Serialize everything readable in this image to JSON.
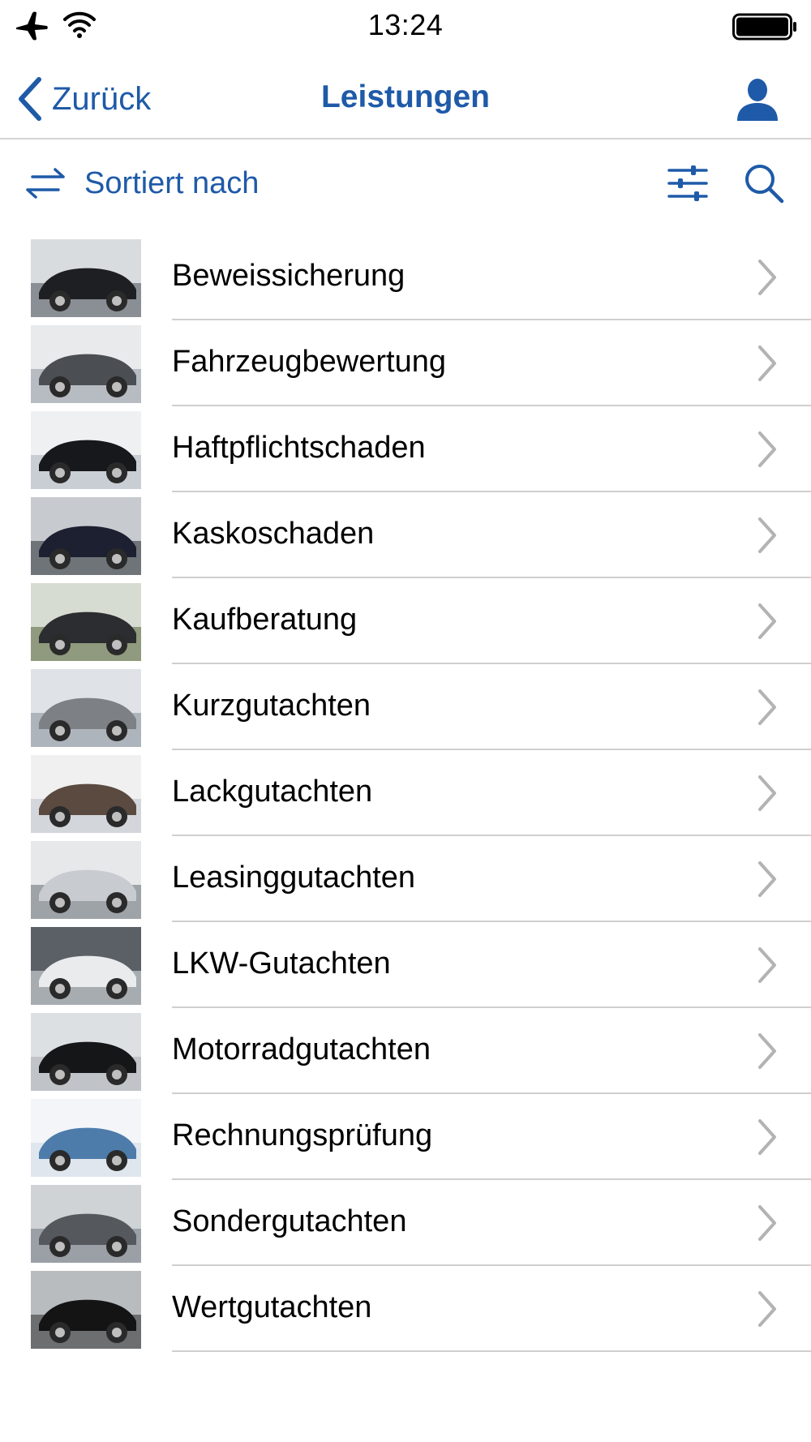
{
  "status_bar": {
    "time": "13:24",
    "icons": [
      "airplane-icon",
      "wifi-icon",
      "battery-icon"
    ]
  },
  "nav": {
    "back_label": "Zurück",
    "title": "Leistungen",
    "profile_icon": "person-icon"
  },
  "toolbar": {
    "sort_label": "Sortiert nach",
    "icons": [
      "sort-arrows-icon",
      "filter-sliders-icon",
      "search-icon"
    ]
  },
  "colors": {
    "accent": "#1e5aa8",
    "text": "#000000",
    "divider": "#cfcfcf",
    "chevron": "#b3b3b3"
  },
  "services": [
    {
      "label": "Beweissicherung"
    },
    {
      "label": "Fahrzeugbewertung"
    },
    {
      "label": "Haftpflichtschaden"
    },
    {
      "label": "Kaskoschaden"
    },
    {
      "label": "Kaufberatung"
    },
    {
      "label": "Kurzgutachten"
    },
    {
      "label": "Lackgutachten"
    },
    {
      "label": "Leasinggutachten"
    },
    {
      "label": "LKW-Gutachten"
    },
    {
      "label": "Motorradgutachten"
    },
    {
      "label": "Rechnungsprüfung"
    },
    {
      "label": "Sondergutachten"
    },
    {
      "label": "Wertgutachten"
    }
  ]
}
